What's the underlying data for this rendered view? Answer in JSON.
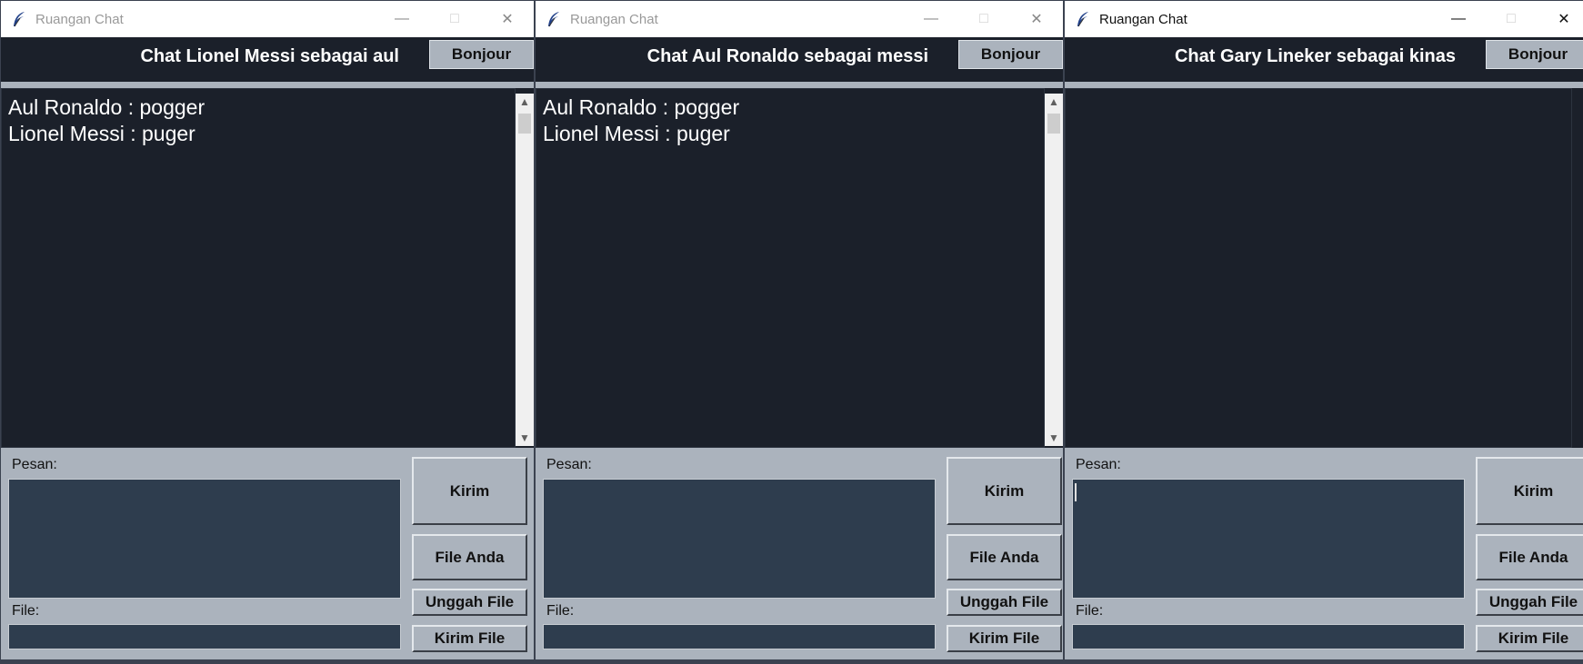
{
  "windows": [
    {
      "title": "Ruangan Chat",
      "header_title": "Chat Lionel Messi sebagai aul",
      "header_button": "Bonjour",
      "messages": [
        "Aul Ronaldo : pogger",
        "Lionel Messi : puger"
      ],
      "pesan_label": "Pesan:",
      "file_label": "File:",
      "buttons": {
        "kirim": "Kirim",
        "file_anda": "File Anda",
        "unggah_file": "Unggah File",
        "kirim_file": "Kirim File"
      }
    },
    {
      "title": "Ruangan Chat",
      "header_title": "Chat Aul Ronaldo sebagai messi",
      "header_button": "Bonjour",
      "messages": [
        "Aul Ronaldo : pogger",
        "Lionel Messi : puger"
      ],
      "pesan_label": "Pesan:",
      "file_label": "File:",
      "buttons": {
        "kirim": "Kirim",
        "file_anda": "File Anda",
        "unggah_file": "Unggah File",
        "kirim_file": "Kirim File"
      }
    },
    {
      "title": "Ruangan Chat",
      "header_title": "Chat Gary Lineker sebagai kinas",
      "header_button": "Bonjour",
      "messages": [],
      "pesan_label": "Pesan:",
      "file_label": "File:",
      "buttons": {
        "kirim": "Kirim",
        "file_anda": "File Anda",
        "unggah_file": "Unggah File",
        "kirim_file": "Kirim File"
      }
    }
  ],
  "icons": {
    "app": "feather-icon",
    "minimize": "minimize-icon",
    "maximize": "maximize-icon",
    "close": "close-icon",
    "scroll_up": "chevron-up-icon",
    "scroll_down": "chevron-down-icon"
  },
  "colors": {
    "chat_background": "#1b202a",
    "panel": "#abb3bd",
    "input_field": "#2e3d4e",
    "text_light": "#ffffff"
  }
}
